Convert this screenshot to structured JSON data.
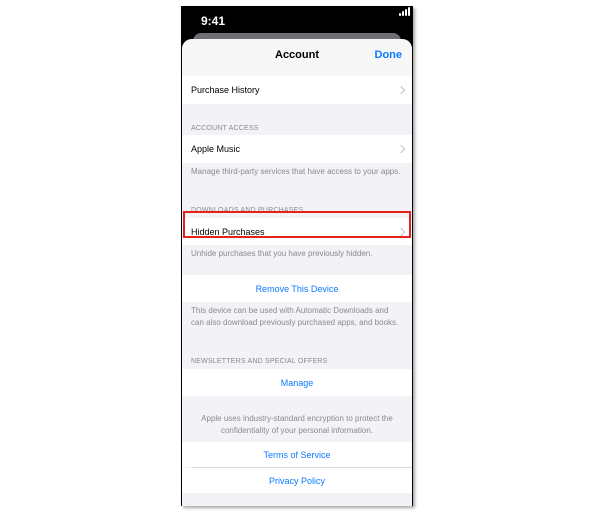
{
  "status_bar": {
    "time": "9:41"
  },
  "nav": {
    "title": "Account",
    "done_label": "Done"
  },
  "rows": {
    "purchase_history": "Purchase History",
    "account_access_header": "ACCOUNT ACCESS",
    "apple_music": "Apple Music",
    "apple_music_footer": "Manage third-party services that have access to your apps.",
    "downloads_header": "DOWNLOADS AND PURCHASES",
    "hidden_purchases": "Hidden Purchases",
    "hidden_purchases_footer": "Unhide purchases that you have previously hidden.",
    "remove_device": "Remove This Device",
    "remove_device_footer": "This device can be used with Automatic Downloads and can also download previously purchased apps, and books.",
    "newsletters_header": "NEWSLETTERS AND SPECIAL OFFERS",
    "manage": "Manage",
    "encryption_note": "Apple uses industry-standard encryption to protect the confidentiality of your personal information.",
    "terms": "Terms of Service",
    "privacy": "Privacy Policy"
  },
  "colors": {
    "accent": "#0a7aff",
    "highlight": "#e3231b",
    "grouped_bg": "#f2f2f7"
  }
}
